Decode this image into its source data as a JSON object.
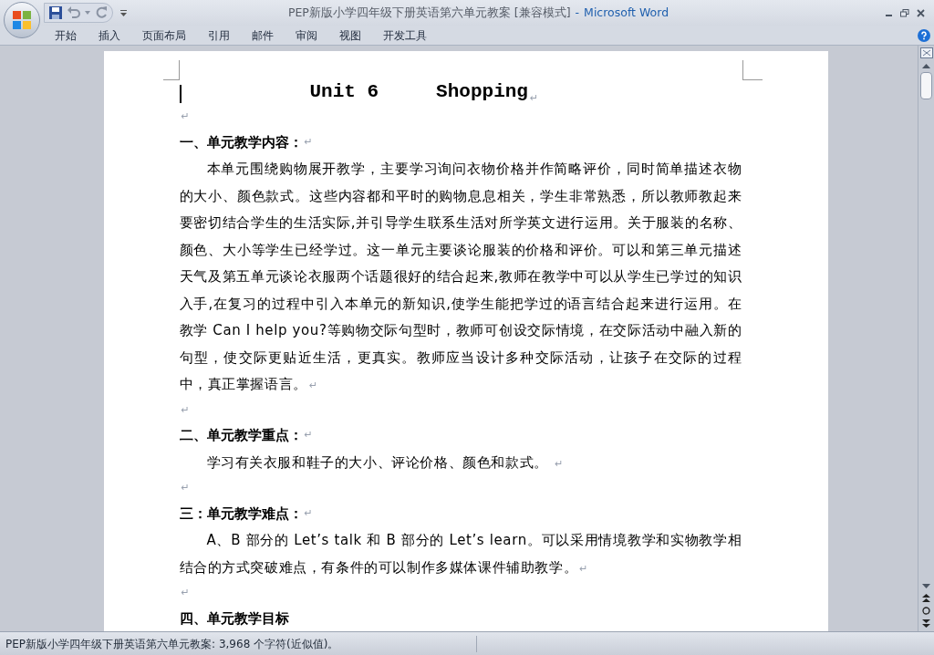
{
  "window": {
    "title": "PEP新版小学四年级下册英语第六单元教案 [兼容模式]",
    "separator": "-",
    "app_name": "Microsoft Word"
  },
  "ribbon_tabs": [
    {
      "label": "开始",
      "selected": false
    },
    {
      "label": "插入",
      "selected": false
    },
    {
      "label": "页面布局",
      "selected": false
    },
    {
      "label": "引用",
      "selected": false
    },
    {
      "label": "邮件",
      "selected": false
    },
    {
      "label": "审阅",
      "selected": false
    },
    {
      "label": "视图",
      "selected": false
    },
    {
      "label": "开发工具",
      "selected": false
    }
  ],
  "document": [
    {
      "kind": "title",
      "text": "Unit 6     Shopping",
      "end_mark": "↵"
    },
    {
      "kind": "empty",
      "end_mark": "↵"
    },
    {
      "kind": "heading",
      "text": "一、单元教学内容：",
      "end_mark": "↵"
    },
    {
      "kind": "para",
      "text": "本单元围绕购物展开教学，主要学习询问衣物价格并作简略评价，同时简单描述衣物的大小、颜色款式。这些内容都和平时的购物息息相关，学生非常熟悉，所以教师教起来要密切结合学生的生活实际,并引导学生联系生活对所学英文进行运用。关于服装的名称、颜色、大小等学生已经学过。这一单元主要谈论服装的价格和评价。可以和第三单元描述天气及第五单元谈论衣服两个话题很好的结合起来,教师在教学中可以从学生已学过的知识入手,在复习的过程中引入本单元的新知识,使学生能把学过的语言结合起来进行运用。在教学 Can I help you?等购物交际句型时，教师可创设交际情境，在交际活动中融入新的句型，使交际更贴近生活，更真实。教师应当设计多种交际活动，让孩子在交际的过程中，真正掌握语言。",
      "end_mark": "↵"
    },
    {
      "kind": "empty",
      "end_mark": "↵"
    },
    {
      "kind": "heading",
      "text": "二、单元教学重点：",
      "end_mark": "↵"
    },
    {
      "kind": "para",
      "text": "学习有关衣服和鞋子的大小、评论价格、颜色和款式。 ",
      "end_mark": "↵"
    },
    {
      "kind": "empty",
      "end_mark": "↵"
    },
    {
      "kind": "heading",
      "text": "三：单元教学难点：",
      "end_mark": "↵"
    },
    {
      "kind": "para",
      "text": "A、B 部分的 Let’s talk 和 B 部分的 Let’s learn。可以采用情境教学和实物教学相结合的方式突破难点，有条件的可以制作多媒体课件辅助教学。",
      "end_mark": "↵"
    },
    {
      "kind": "empty",
      "end_mark": "↵"
    },
    {
      "kind": "heading",
      "text": "四、单元教学目标"
    }
  ],
  "status_bar": {
    "text": "PEP新版小学四年级下册英语第六单元教案: 3,968 个字符(近似值)。"
  }
}
